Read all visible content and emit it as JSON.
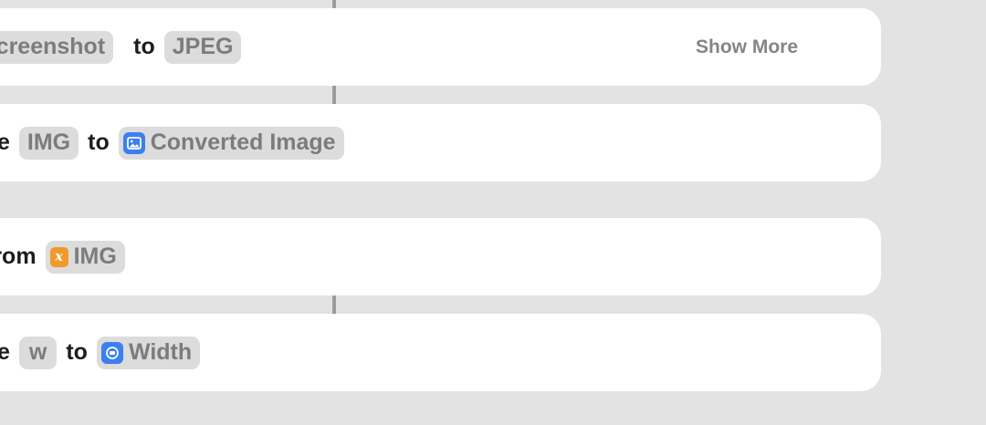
{
  "actions": [
    {
      "prefix": "",
      "tokens": [
        {
          "text": "Screenshot",
          "icon": null
        },
        {
          "word": "to"
        },
        {
          "text": "JPEG",
          "icon": null
        }
      ],
      "show_more": "Show More"
    },
    {
      "prefix": "e",
      "tokens": [
        {
          "text": "IMG",
          "icon": null
        },
        {
          "word": "to"
        },
        {
          "text": "Converted Image",
          "icon": "image-icon",
          "icon_color": "#3b7ff2"
        }
      ]
    },
    {
      "prefix": "",
      "tokens": [
        {
          "word": "from"
        },
        {
          "text": "IMG",
          "icon": "variable-icon",
          "icon_color": "#f09a2a",
          "icon_glyph": "x"
        }
      ]
    },
    {
      "prefix": "e",
      "tokens": [
        {
          "text": "w",
          "icon": null
        },
        {
          "word": "to"
        },
        {
          "text": "Width",
          "icon": "dimension-icon",
          "icon_color": "#3b7ff2"
        }
      ]
    }
  ],
  "labels": {
    "card1_token1": "Screenshot",
    "card1_word": "to",
    "card1_token2": "JPEG",
    "card1_show_more": "Show More",
    "card2_prefix": "e",
    "card2_token1": "IMG",
    "card2_word": "to",
    "card2_token2": "Converted Image",
    "card3_word": "from",
    "card3_token1": "IMG",
    "card3_icon_glyph": "x",
    "card4_prefix": "e",
    "card4_token1": "w",
    "card4_word": "to",
    "card4_token2": "Width"
  },
  "colors": {
    "background": "#e3e3e3",
    "card": "#ffffff",
    "token_bg": "#dcdcdc",
    "token_text": "#7b7b80",
    "accent_blue": "#3b7ff2",
    "accent_orange": "#f09a2a"
  }
}
